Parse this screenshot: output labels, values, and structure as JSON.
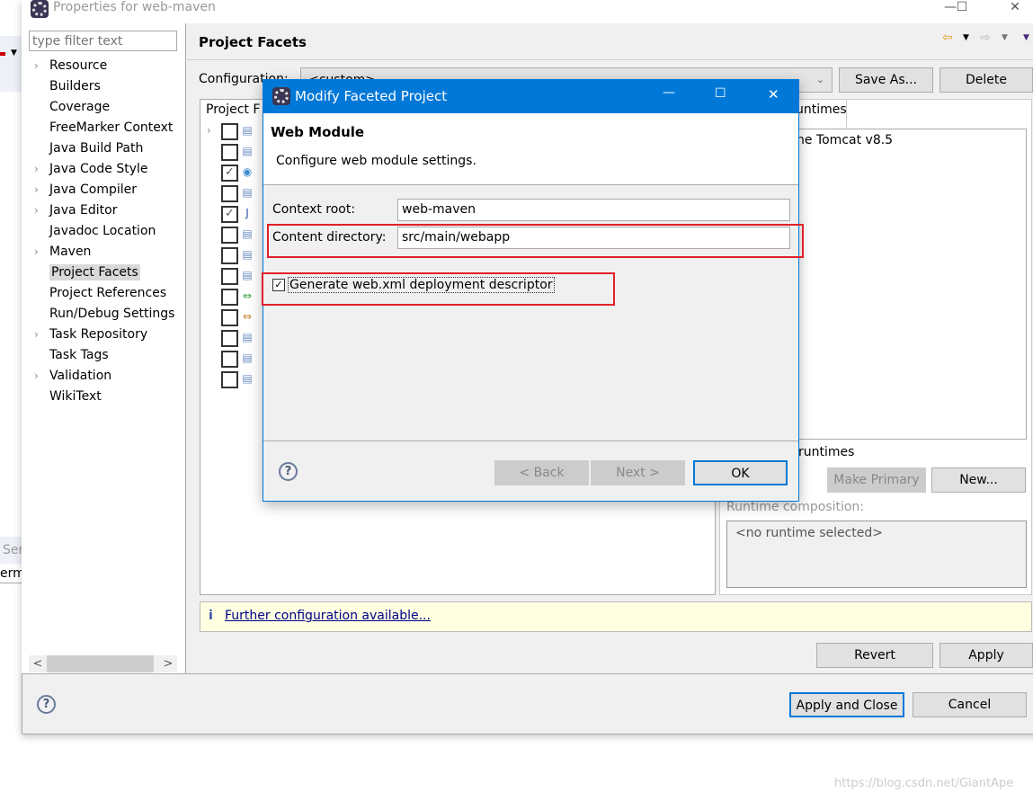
{
  "window": {
    "title": "Properties for web-maven",
    "controls": {
      "minimize": "—",
      "maximize": "☐",
      "close": "✕"
    }
  },
  "background": {
    "fragment1": "Ser",
    "fragment2": "erm"
  },
  "sidebar": {
    "filter_placeholder": "type filter text",
    "items": [
      {
        "label": "Resource",
        "expandable": true
      },
      {
        "label": "Builders",
        "expandable": false
      },
      {
        "label": "Coverage",
        "expandable": false
      },
      {
        "label": "FreeMarker Context",
        "expandable": false
      },
      {
        "label": "Java Build Path",
        "expandable": false
      },
      {
        "label": "Java Code Style",
        "expandable": true
      },
      {
        "label": "Java Compiler",
        "expandable": true
      },
      {
        "label": "Java Editor",
        "expandable": true
      },
      {
        "label": "Javadoc Location",
        "expandable": false
      },
      {
        "label": "Maven",
        "expandable": true
      },
      {
        "label": "Project Facets",
        "expandable": false,
        "selected": true
      },
      {
        "label": "Project References",
        "expandable": false
      },
      {
        "label": "Run/Debug Settings",
        "expandable": false
      },
      {
        "label": "Task Repository",
        "expandable": true
      },
      {
        "label": "Task Tags",
        "expandable": false
      },
      {
        "label": "Validation",
        "expandable": true
      },
      {
        "label": "WikiText",
        "expandable": false
      }
    ]
  },
  "page": {
    "title": "Project Facets",
    "configuration_label": "Configuration:",
    "configuration_value": "<custom>",
    "save_as": "Save As...",
    "delete": "Delete",
    "facets_header": "Project F",
    "facets": [
      {
        "checked": false,
        "icon": "doc",
        "expandable": true
      },
      {
        "checked": false,
        "icon": "doc"
      },
      {
        "checked": true,
        "icon": "globe"
      },
      {
        "checked": false,
        "icon": "doc"
      },
      {
        "checked": true,
        "icon": "java"
      },
      {
        "checked": false,
        "icon": "doc"
      },
      {
        "checked": false,
        "icon": "doc"
      },
      {
        "checked": false,
        "icon": "doc"
      },
      {
        "checked": false,
        "icon": "arrows-green"
      },
      {
        "checked": false,
        "icon": "arrows-orange"
      },
      {
        "checked": false,
        "icon": "doc"
      },
      {
        "checked": false,
        "icon": "doc"
      },
      {
        "checked": false,
        "icon": "doc"
      }
    ],
    "runtimes_tab": "untimes",
    "runtime_item": "he Tomcat v8.5",
    "runtimes_label": "runtimes",
    "make_primary": "Make Primary",
    "new": "New...",
    "runtime_composition_label": "Runtime composition:",
    "runtime_composition_value": "<no runtime selected>",
    "info_link": "Further configuration available...",
    "revert": "Revert",
    "apply": "Apply",
    "apply_and_close": "Apply and Close",
    "cancel": "Cancel"
  },
  "modal": {
    "title": "Modify Faceted Project",
    "heading": "Web Module",
    "description": "Configure web module settings.",
    "context_root_label": "Context root:",
    "context_root_value": "web-maven",
    "content_dir_label": "Content directory:",
    "content_dir_value": "src/main/webapp",
    "generate_label": "Generate web.xml deployment descriptor",
    "generate_checked": true,
    "back": "< Back",
    "next": "Next >",
    "ok": "OK"
  },
  "watermark": "https://blog.csdn.net/GiantApe",
  "colors": {
    "accent": "#0078d7",
    "highlight": "#e0202a",
    "info_bg": "#ffffe1",
    "link": "#00008b"
  }
}
